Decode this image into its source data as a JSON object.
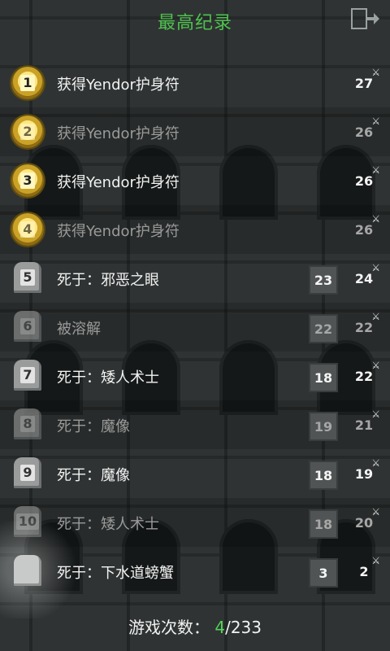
{
  "header": {
    "title": "最高纪录"
  },
  "records": [
    {
      "rank": "1",
      "text": "获得Yendor护身符",
      "depth": "",
      "level": "27",
      "type": "medal"
    },
    {
      "rank": "2",
      "text": "获得Yendor护身符",
      "depth": "",
      "level": "26",
      "type": "medal"
    },
    {
      "rank": "3",
      "text": "获得Yendor护身符",
      "depth": "",
      "level": "26",
      "type": "medal"
    },
    {
      "rank": "4",
      "text": "获得Yendor护身符",
      "depth": "",
      "level": "26",
      "type": "medal"
    },
    {
      "rank": "5",
      "text": "死于：邪恶之眼",
      "depth": "23",
      "level": "24",
      "type": "tomb"
    },
    {
      "rank": "6",
      "text": "被溶解",
      "depth": "22",
      "level": "22",
      "type": "tomb"
    },
    {
      "rank": "7",
      "text": "死于：矮人术士",
      "depth": "18",
      "level": "22",
      "type": "tomb"
    },
    {
      "rank": "8",
      "text": "死于：魔像",
      "depth": "19",
      "level": "21",
      "type": "tomb"
    },
    {
      "rank": "9",
      "text": "死于：魔像",
      "depth": "18",
      "level": "19",
      "type": "tomb"
    },
    {
      "rank": "10",
      "text": "死于：矮人术士",
      "depth": "18",
      "level": "20",
      "type": "tomb"
    },
    {
      "rank": "",
      "text": "死于：下水道螃蟹",
      "depth": "3",
      "level": "2",
      "type": "tomb-new"
    }
  ],
  "footer": {
    "label": "游戏次数：",
    "current": "4",
    "total": "/233"
  },
  "icons": {
    "exit": "exit-icon"
  },
  "colors": {
    "title": "#4ec24e",
    "current": "#55d25a"
  }
}
